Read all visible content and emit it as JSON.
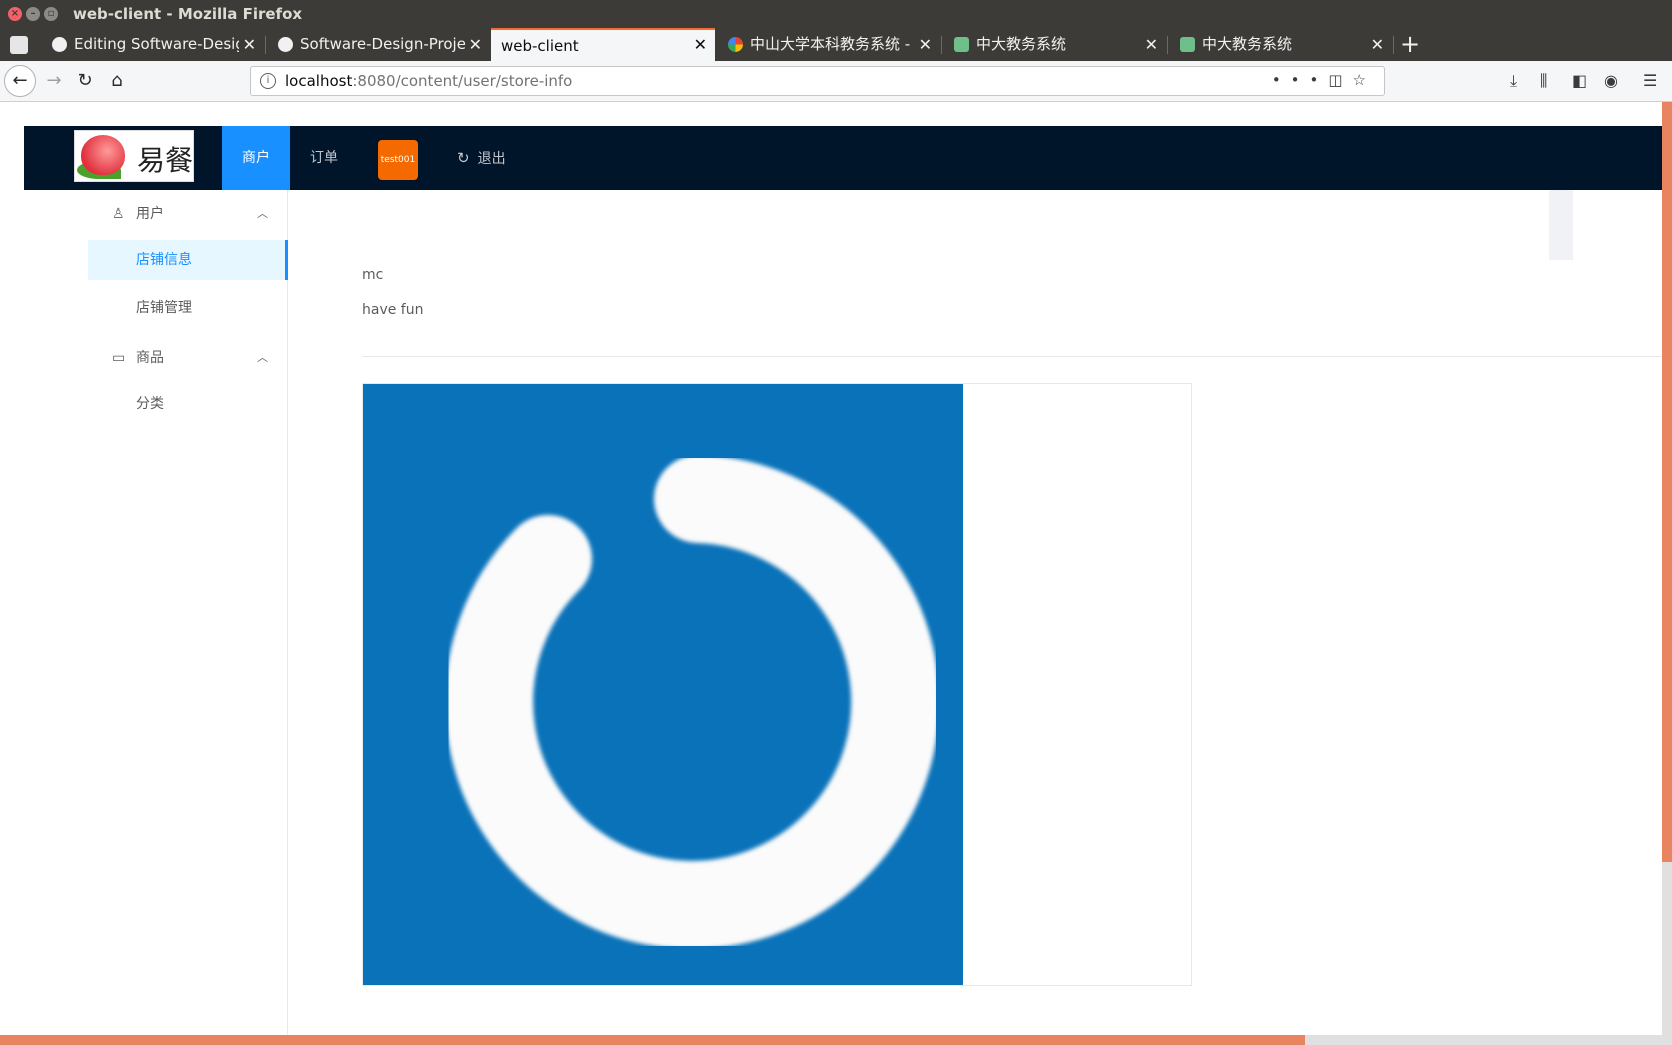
{
  "window": {
    "title": "web-client - Mozilla Firefox"
  },
  "tabs": [
    {
      "label": "Editing Software-Design",
      "icon": "github-icon"
    },
    {
      "label": "Software-Design-Project",
      "icon": "github-icon"
    },
    {
      "label": "web-client",
      "active": true
    },
    {
      "label": "中山大学本科教务系统 - G",
      "icon": "google-icon"
    },
    {
      "label": "中大教务系统",
      "icon": "sysu-icon"
    },
    {
      "label": "中大教务系统",
      "icon": "sysu-icon"
    }
  ],
  "nav": {
    "url_host": "localhost",
    "url_rest": ":8080/content/user/store-info"
  },
  "app": {
    "logo_text": "易餐",
    "menu": {
      "merchant": "商户",
      "orders": "订单"
    },
    "user_badge": "test001",
    "logout": "退出"
  },
  "sidebar": {
    "user_group": "用户",
    "store_info": "店铺信息",
    "store_manage": "店铺管理",
    "goods_group": "商品",
    "category": "分类"
  },
  "store": {
    "name": "mc",
    "description": "have fun"
  },
  "colors": {
    "header_bg": "#001529",
    "accent": "#1890ff",
    "badge": "#f56a00",
    "image_bg": "#0a72b9"
  }
}
